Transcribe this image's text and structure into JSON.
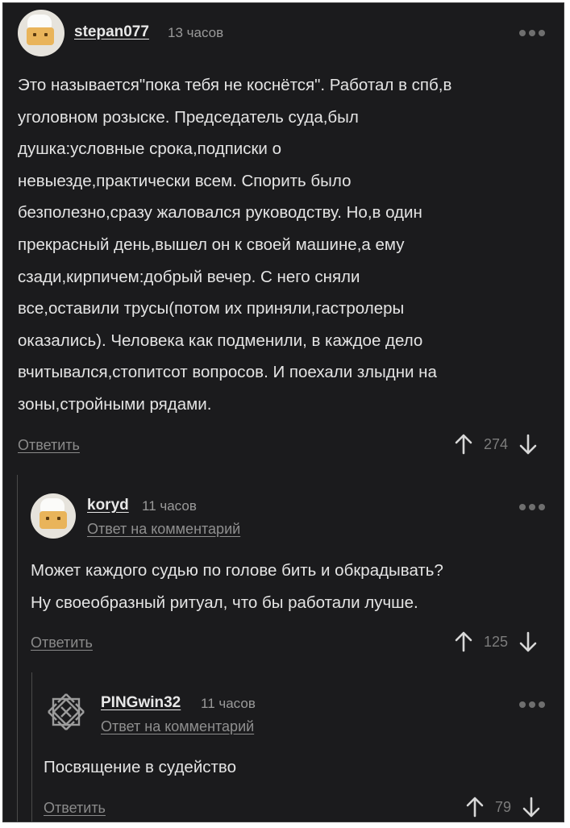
{
  "comments": [
    {
      "username": "stepan077",
      "time": "13 часов",
      "text": "Это называется\"пока тебя не коснётся\". Работал в спб,в уголовном розыске. Председатель суда,был душка:условные срока,подписки о невыезде,практически всем. Спорить было безполезно,сразу жаловался руководству. Но,в один прекрасный день,вышел он к своей машине,а ему сзади,кирпичем:добрый вечер. С него сняли все,оставили трусы(потом их приняли,гастролеры оказались). Человека как подменили, в каждое дело вчитывался,стопитсот вопросов. И поехали злыдни на зоны,стройными рядами.",
      "lines": [
        "Это называется\"пока тебя не коснётся\". Работал в спб,в",
        "уголовном розыске. Председатель суда,был",
        "душка:условные срока,подписки о",
        "невыезде,практически всем. Спорить было",
        "безполезно,сразу жаловался руководству. Но,в один",
        "прекрасный день,вышел он к своей машине,а ему",
        "сзади,кирпичем:добрый вечер. С него сняли",
        "все,оставили трусы(потом их приняли,гастролеры",
        "оказались). Человека как подменили, в каждое дело",
        "вчитывался,стопитсот вопросов. И поехали злыдни на",
        "зоны,стройными рядами."
      ],
      "reply_label": "Ответить",
      "rating": "274"
    },
    {
      "username": "koryd",
      "time": "11 часов",
      "reply_to": "Ответ на комментарий",
      "lines": [
        "Может каждого судью по голове бить и обкрадывать?",
        "Ну своеобразный ритуал, что бы работали лучше."
      ],
      "reply_label": "Ответить",
      "rating": "125"
    },
    {
      "username": "PINGwin32",
      "time": "11 часов",
      "reply_to": "Ответ на комментарий",
      "lines": [
        "Посвящение в судейство"
      ],
      "reply_label": "Ответить",
      "rating": "79"
    }
  ],
  "icons": {
    "upvote": "arrow-up-icon",
    "downvote": "arrow-down-icon",
    "more": "more-dots-icon"
  },
  "colors": {
    "background": "#1b1b1d",
    "text": "#e4e4e4",
    "muted": "#8a8a8a"
  }
}
